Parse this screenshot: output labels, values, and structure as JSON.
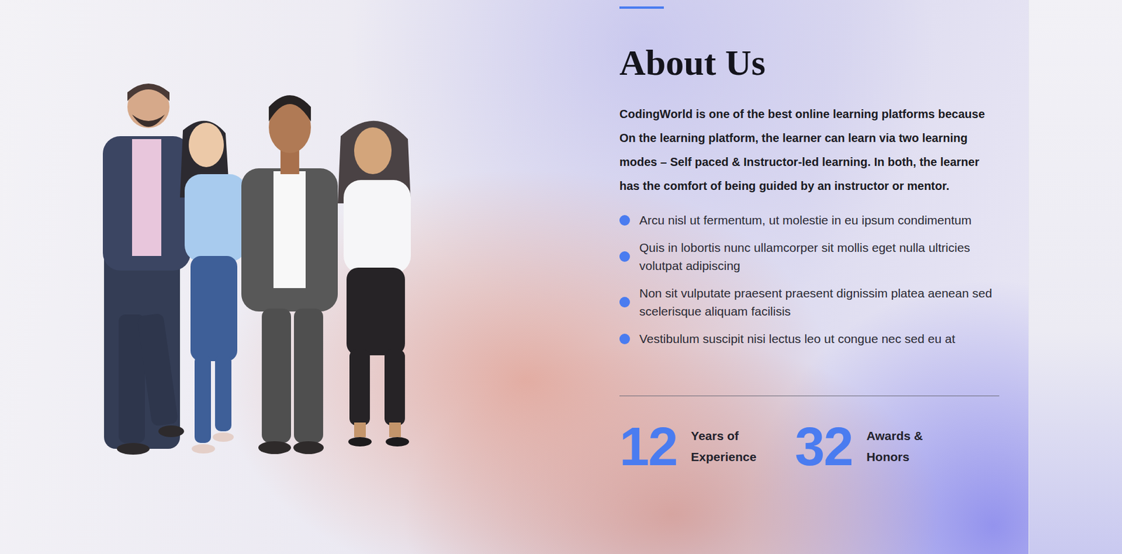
{
  "section": {
    "heading": "About Us",
    "intro": "CodingWorld is one of the best online learning platforms because On the learning platform, the learner can learn via two learning modes – Self paced & Instructor-led learning. In both, the learner has the comfort of being guided by an instructor or mentor.",
    "bullets": [
      "Arcu nisl ut fermentum, ut molestie in eu ipsum condimentum",
      "Quis in lobortis nunc ullamcorper sit mollis eget nulla ultricies volutpat adipiscing",
      "Non sit vulputate praesent praesent dignissim platea aenean sed scelerisque aliquam facilisis",
      "Vestibulum suscipit nisi lectus leo ut congue nec sed eu at"
    ],
    "stats": [
      {
        "number": "12",
        "label": "Years of Experience"
      },
      {
        "number": "32",
        "label": "Awards & Honors"
      }
    ]
  }
}
